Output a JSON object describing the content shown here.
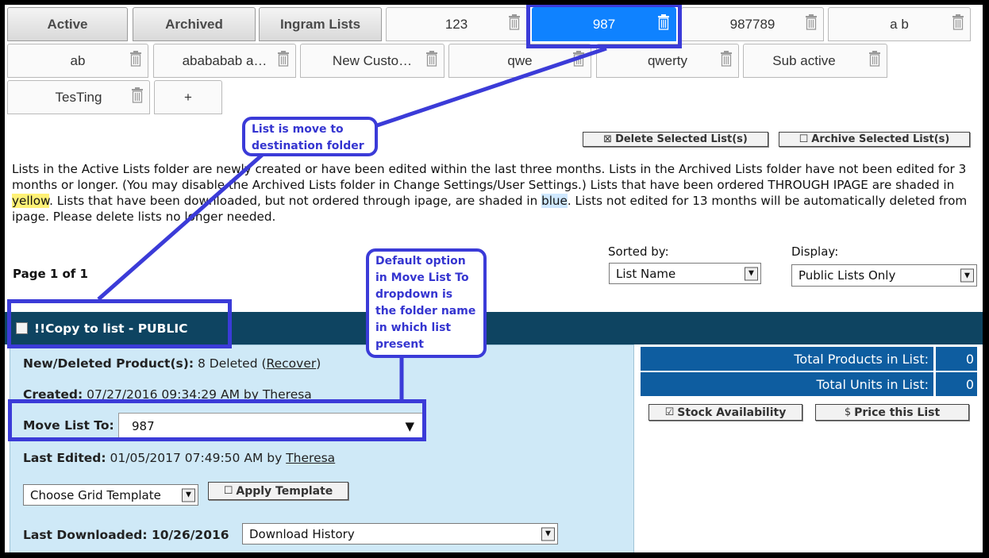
{
  "folder_tabs": [
    "Active",
    "Archived",
    "Ingram Lists"
  ],
  "list_tabs_row1": [
    {
      "label": "123"
    },
    {
      "label": "987",
      "selected": true
    },
    {
      "label": "987789"
    },
    {
      "label": "a b"
    }
  ],
  "list_tabs_row2": [
    {
      "label": "ab"
    },
    {
      "label": "abababab a…"
    },
    {
      "label": "New Custo…"
    },
    {
      "label": "qwe"
    },
    {
      "label": "qwerty"
    },
    {
      "label": "Sub active"
    }
  ],
  "list_tabs_row3": [
    {
      "label": "TesTing"
    }
  ],
  "add_tab_label": "+",
  "actions": {
    "delete_label": "Delete Selected List(s)",
    "archive_label": "Archive Selected List(s)"
  },
  "info": {
    "part1": "Lists in the Active Lists folder are newly created or have been edited within the last three months. Lists in the Archived Lists folder have not been edited for 3 months or longer. (You may disable the Archived Lists folder in Change Settings/User Settings.) Lists that have been ordered THROUGH IPAGE are shaded in ",
    "yellow": "yellow",
    "part2": ". Lists that have been downloaded, but not ordered through ipage, are shaded in ",
    "blue": "blue",
    "part3": ". Lists not edited for 13 months will be automatically deleted from ipage. Please delete lists no longer needed."
  },
  "page_indicator": "Page 1 of 1",
  "sorted_by": {
    "label": "Sorted by:",
    "value": "List Name"
  },
  "display": {
    "label": "Display:",
    "value": "Public Lists Only"
  },
  "list": {
    "title": "!!Copy to list - PUBLIC",
    "new_deleted_label": "New/Deleted Product(s):",
    "new_deleted_value": "8 Deleted (",
    "recover_link": "Recover",
    "new_deleted_close": ")",
    "created_label": "Created:",
    "created_value": "07/27/2016 09:34:29 AM by",
    "created_by": "Theresa",
    "move_label": "Move List To:",
    "move_value": "987",
    "edited_label": "Last Edited:",
    "edited_value": "01/05/2017 07:49:50 AM by",
    "edited_by": "Theresa",
    "grid_template": "Choose Grid Template",
    "apply_template": "Apply Template",
    "downloaded_label": "Last Downloaded: 10/26/2016",
    "download_history": "Download History"
  },
  "stats": {
    "products_label": "Total Products in List:",
    "products_value": "0",
    "units_label": "Total Units in List:",
    "units_value": "0"
  },
  "buttons": {
    "stock": "Stock Availability",
    "price": "Price this List"
  },
  "callouts": {
    "destination": "List is move to destination folder",
    "default_option": "Default option in Move List To dropdown is the folder name in which list present"
  },
  "colors": {
    "selected_tab": "#0f82ff",
    "header": "#0e4461",
    "panel": "#cfe9f7",
    "stat": "#0e5da0",
    "annotation": "#3b3bd8"
  }
}
